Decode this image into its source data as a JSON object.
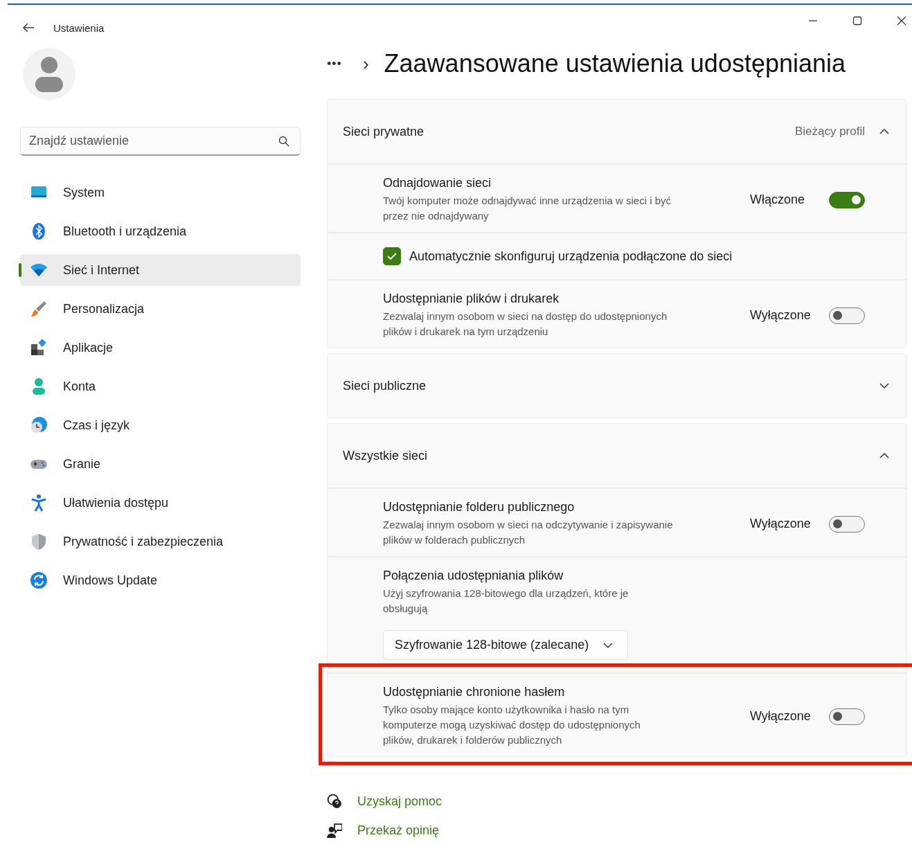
{
  "window": {
    "title": "Ustawienia"
  },
  "search": {
    "placeholder": "Znajdź ustawienie"
  },
  "sidebar": {
    "items": [
      {
        "label": "System",
        "selected": false
      },
      {
        "label": "Bluetooth i urządzenia",
        "selected": false
      },
      {
        "label": "Sieć i Internet",
        "selected": true
      },
      {
        "label": "Personalizacja",
        "selected": false
      },
      {
        "label": "Aplikacje",
        "selected": false
      },
      {
        "label": "Konta",
        "selected": false
      },
      {
        "label": "Czas i język",
        "selected": false
      },
      {
        "label": "Granie",
        "selected": false
      },
      {
        "label": "Ułatwienia dostępu",
        "selected": false
      },
      {
        "label": "Prywatność i zabezpieczenia",
        "selected": false
      },
      {
        "label": "Windows Update",
        "selected": false
      }
    ]
  },
  "breadcrumb": {
    "ellipsis": "•••",
    "separator": "›",
    "title": "Zaawansowane ustawienia udostępniania"
  },
  "sections": [
    {
      "title": "Sieci prywatne",
      "badge": "Bieżący profil",
      "expanded": true,
      "rows": [
        {
          "kind": "toggle",
          "title": "Odnajdowanie sieci",
          "description": "Twój komputer może odnajdywać inne urządzenia w sieci i być przez nie odnajdywany",
          "state_label": "Włączone",
          "on": true,
          "highlighted": false
        },
        {
          "kind": "checkbox",
          "label": "Automatycznie skonfiguruj urządzenia podłączone do sieci",
          "checked": true
        },
        {
          "kind": "toggle",
          "title": "Udostępnianie plików i drukarek",
          "description": "Zezwalaj innym osobom w sieci na dostęp do udostępnionych plików i drukarek na tym urządzeniu",
          "state_label": "Wyłączone",
          "on": false,
          "highlighted": false
        }
      ]
    },
    {
      "title": "Sieci publiczne",
      "expanded": false
    },
    {
      "title": "Wszystkie sieci",
      "expanded": true,
      "rows": [
        {
          "kind": "toggle",
          "title": "Udostępnianie folderu publicznego",
          "description": "Zezwalaj innym osobom w sieci na odczytywanie i zapisywanie plików w folderach publicznych",
          "state_label": "Wyłączone",
          "on": false,
          "highlighted": false
        },
        {
          "kind": "dropdown",
          "title": "Połączenia udostępniania plików",
          "description": "Użyj szyfrowania 128-bitowego dla urządzeń, które je obsługują",
          "value": "Szyfrowanie 128-bitowe (zalecane)"
        },
        {
          "kind": "toggle",
          "title": "Udostępnianie chronione hasłem",
          "description": "Tylko osoby mające konto użytkownika i hasło na tym komputerze mogą uzyskiwać dostęp do udostępnionych plików, drukarek i folderów publicznych",
          "state_label": "Wyłączone",
          "on": false,
          "highlighted": true
        }
      ]
    }
  ],
  "links": [
    {
      "label": "Uzyskaj pomoc"
    },
    {
      "label": "Przekaż opinię"
    }
  ]
}
